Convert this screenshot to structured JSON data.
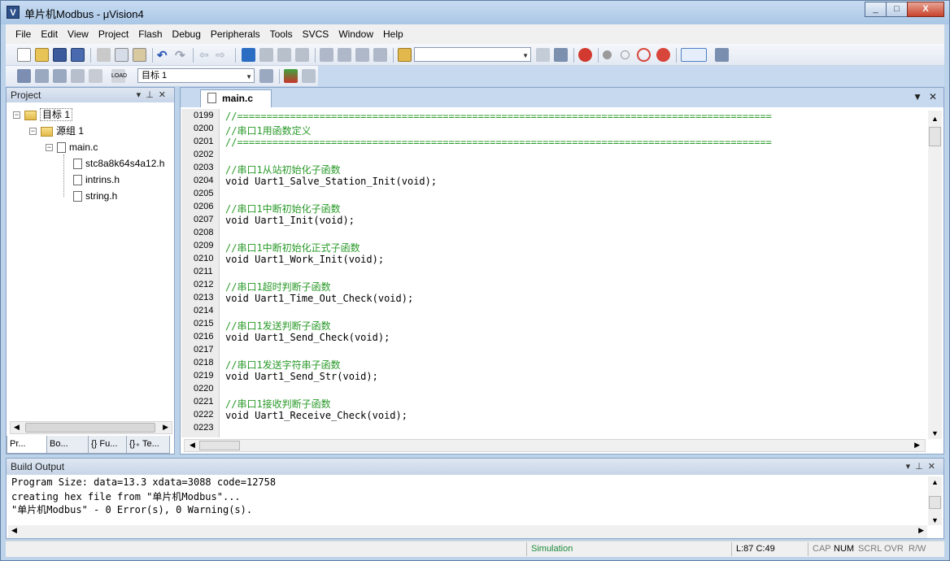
{
  "window": {
    "title": "单片机Modbus - μVision4",
    "controls": [
      "_",
      "□",
      "X"
    ]
  },
  "menu": [
    "File",
    "Edit",
    "View",
    "Project",
    "Flash",
    "Debug",
    "Peripherals",
    "Tools",
    "SVCS",
    "Window",
    "Help"
  ],
  "toolbar2": {
    "target_select": "目标 1"
  },
  "project": {
    "title": "Project",
    "tree": [
      {
        "label": "目标 1",
        "level": 0,
        "type": "target"
      },
      {
        "label": "源组 1",
        "level": 1,
        "type": "folder"
      },
      {
        "label": "main.c",
        "level": 2,
        "type": "file"
      },
      {
        "label": "stc8a8k64s4a12.h",
        "level": 3,
        "type": "header"
      },
      {
        "label": "intrins.h",
        "level": 3,
        "type": "header"
      },
      {
        "label": "string.h",
        "level": 3,
        "type": "header"
      }
    ],
    "tabs": [
      "Pr...",
      "Bo...",
      "{} Fu...",
      "{}₊ Te..."
    ]
  },
  "editor": {
    "active_tab": "main.c",
    "lines": [
      {
        "n": "0199",
        "text": "//===========================================================================================",
        "comment": true
      },
      {
        "n": "0200",
        "text": "//串口1用函数定义",
        "comment": true
      },
      {
        "n": "0201",
        "text": "//===========================================================================================",
        "comment": true
      },
      {
        "n": "0202",
        "text": "",
        "comment": false
      },
      {
        "n": "0203",
        "text": "//串口1从站初始化子函数",
        "comment": true
      },
      {
        "n": "0204",
        "text": "void Uart1_Salve_Station_Init(void);",
        "comment": false
      },
      {
        "n": "0205",
        "text": "",
        "comment": false
      },
      {
        "n": "0206",
        "text": "//串口1中断初始化子函数",
        "comment": true
      },
      {
        "n": "0207",
        "text": "void Uart1_Init(void);",
        "comment": false
      },
      {
        "n": "0208",
        "text": "",
        "comment": false
      },
      {
        "n": "0209",
        "text": "//串口1中断初始化正式子函数",
        "comment": true
      },
      {
        "n": "0210",
        "text": "void Uart1_Work_Init(void);",
        "comment": false
      },
      {
        "n": "0211",
        "text": "",
        "comment": false
      },
      {
        "n": "0212",
        "text": "//串口1超时判断子函数",
        "comment": true
      },
      {
        "n": "0213",
        "text": "void Uart1_Time_Out_Check(void);",
        "comment": false
      },
      {
        "n": "0214",
        "text": "",
        "comment": false
      },
      {
        "n": "0215",
        "text": "//串口1发送判断子函数",
        "comment": true
      },
      {
        "n": "0216",
        "text": "void Uart1_Send_Check(void);",
        "comment": false
      },
      {
        "n": "0217",
        "text": "",
        "comment": false
      },
      {
        "n": "0218",
        "text": "//串口1发送字符串子函数",
        "comment": true
      },
      {
        "n": "0219",
        "text": "void Uart1_Send_Str(void);",
        "comment": false
      },
      {
        "n": "0220",
        "text": "",
        "comment": false
      },
      {
        "n": "0221",
        "text": "//串口1接收判断子函数",
        "comment": true
      },
      {
        "n": "0222",
        "text": "void Uart1_Receive_Check(void);",
        "comment": false
      },
      {
        "n": "0223",
        "text": "",
        "comment": false
      }
    ]
  },
  "build": {
    "title": "Build Output",
    "lines": [
      "Program Size: data=13.3 xdata=3088 code=12758",
      "creating hex file from \"单片机Modbus\"...",
      "\"单片机Modbus\" - 0 Error(s), 0 Warning(s)."
    ]
  },
  "status": {
    "mode": "Simulation",
    "position": "L:87 C:49",
    "indicators": [
      "CAP",
      "NUM",
      "SCRL",
      "OVR",
      "R/W"
    ]
  },
  "colors": {
    "comment": "#2a9a2a",
    "frame": "#bcd3ea",
    "simulation": "#1c8a3a"
  }
}
